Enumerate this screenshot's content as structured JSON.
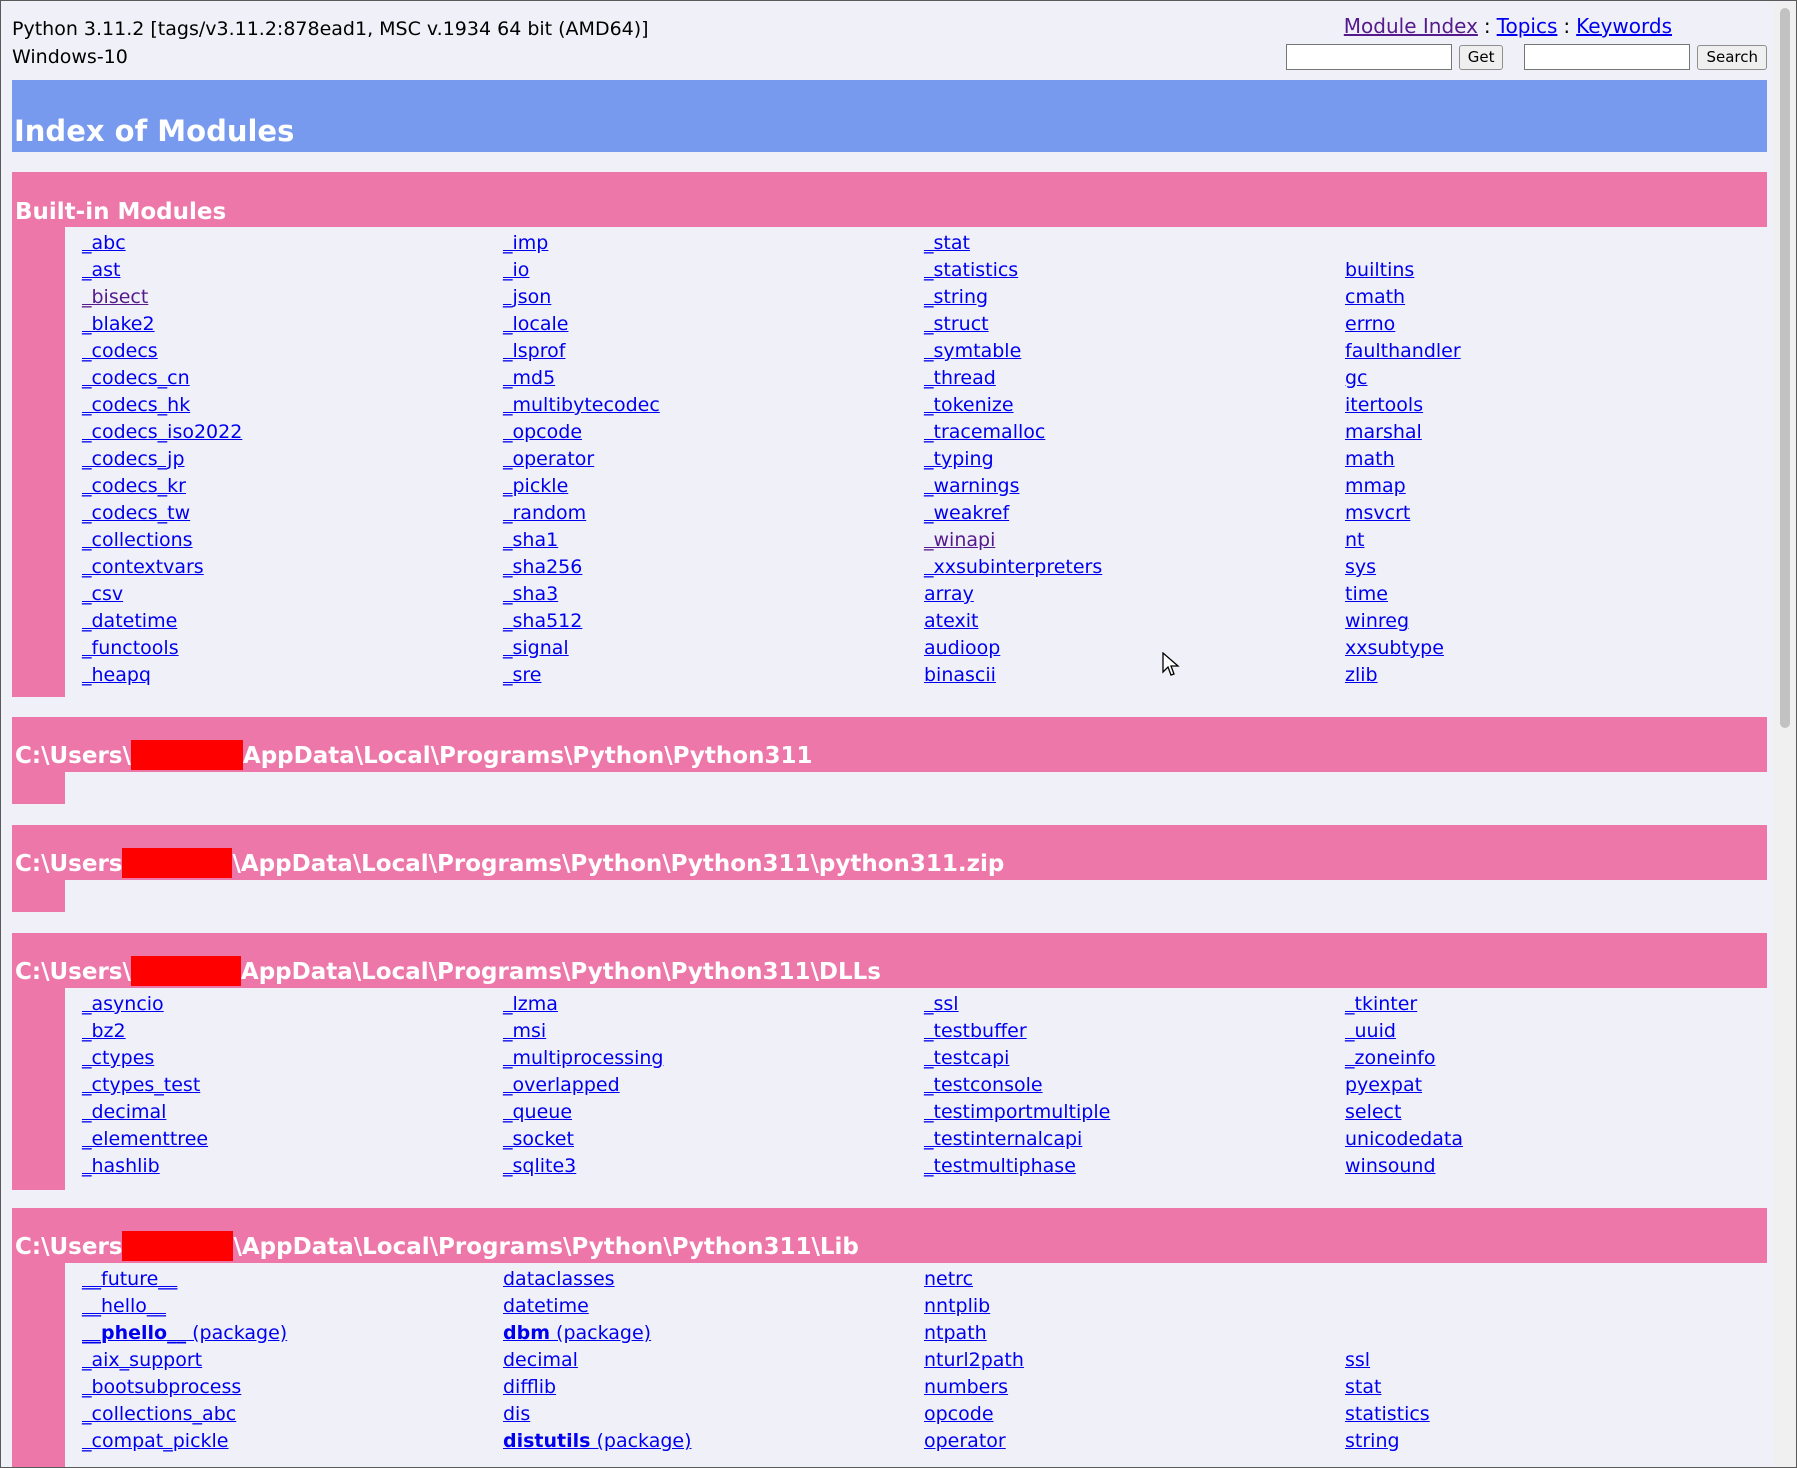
{
  "header": {
    "python_version": "Python 3.11.2 [tags/v3.11.2:878ead1, MSC v.1934 64 bit (AMD64)]",
    "platform": "Windows-10",
    "nav": {
      "module_index": "Module Index",
      "topics": "Topics",
      "keywords": "Keywords",
      "sep": ":"
    },
    "get_button": "Get",
    "search_button": "Search",
    "get_input_value": "",
    "search_input_value": ""
  },
  "page_title": "Index of Modules",
  "sections": [
    {
      "title": "Built-in Modules",
      "columns": [
        [
          "_abc",
          "_ast",
          "_bisect",
          "_blake2",
          "_codecs",
          "_codecs_cn",
          "_codecs_hk",
          "_codecs_iso2022",
          "_codecs_jp",
          "_codecs_kr",
          "_codecs_tw",
          "_collections",
          "_contextvars",
          "_csv",
          "_datetime",
          "_functools",
          "_heapq"
        ],
        [
          "_imp",
          "_io",
          "_json",
          "_locale",
          "_lsprof",
          "_md5",
          "_multibytecodec",
          "_opcode",
          "_operator",
          "_pickle",
          "_random",
          "_sha1",
          "_sha256",
          "_sha3",
          "_sha512",
          "_signal",
          "_sre"
        ],
        [
          "_stat",
          "_statistics",
          "_string",
          "_struct",
          "_symtable",
          "_thread",
          "_tokenize",
          "_tracemalloc",
          "_typing",
          "_warnings",
          "_weakref",
          "_winapi",
          "_xxsubinterpreters",
          "array",
          "atexit",
          "audioop",
          "binascii"
        ],
        [
          "",
          "builtins",
          "cmath",
          "errno",
          "faulthandler",
          "gc",
          "itertools",
          "marshal",
          "math",
          "mmap",
          "msvcrt",
          "nt",
          "sys",
          "time",
          "winreg",
          "xxsubtype",
          "zlib"
        ]
      ]
    },
    {
      "title_prefix": "C:\\Users\\",
      "title_suffix": "AppData\\Local\\Programs\\Python\\Python311"
    },
    {
      "title_prefix": "C:\\Users",
      "title_suffix": "\\AppData\\Local\\Programs\\Python\\Python311\\python311.zip"
    },
    {
      "title_prefix": "C:\\Users\\",
      "title_suffix": "AppData\\Local\\Programs\\Python\\Python311\\DLLs",
      "columns": [
        [
          "_asyncio",
          "_bz2",
          "_ctypes",
          "_ctypes_test",
          "_decimal",
          "_elementtree",
          "_hashlib"
        ],
        [
          "_lzma",
          "_msi",
          "_multiprocessing",
          "_overlapped",
          "_queue",
          "_socket",
          "_sqlite3"
        ],
        [
          "_ssl",
          "_testbuffer",
          "_testcapi",
          "_testconsole",
          "_testimportmultiple",
          "_testinternalcapi",
          "_testmultiphase"
        ],
        [
          "_tkinter",
          "_uuid",
          "_zoneinfo",
          "pyexpat",
          "select",
          "unicodedata",
          "winsound"
        ]
      ]
    },
    {
      "title_prefix": "C:\\Users",
      "title_suffix": "\\AppData\\Local\\Programs\\Python\\Python311\\Lib",
      "columns": [
        [
          "__future__",
          "__hello__",
          "__phello__",
          "_aix_support",
          "_bootsubprocess",
          "_collections_abc",
          "_compat_pickle"
        ],
        [
          "dataclasses",
          "datetime",
          "dbm",
          "decimal",
          "difflib",
          "dis",
          "distutils"
        ],
        [
          "netrc",
          "nntplib",
          "ntpath",
          "nturl2path",
          "numbers",
          "opcode",
          "operator"
        ],
        [
          "",
          "",
          "",
          "ssl",
          "stat",
          "statistics",
          "string"
        ]
      ],
      "package_label": "(package)"
    }
  ]
}
